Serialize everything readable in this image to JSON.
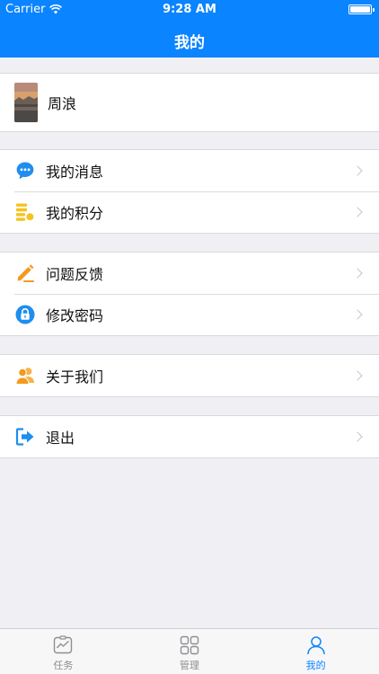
{
  "status_bar": {
    "carrier": "Carrier",
    "time": "9:28 AM"
  },
  "nav": {
    "title": "我的"
  },
  "profile": {
    "name": "周浪"
  },
  "groups": [
    {
      "items": [
        {
          "label": "我的消息",
          "icon": "message-icon",
          "color": "#1e8ef0"
        },
        {
          "label": "我的积分",
          "icon": "points-icon",
          "color": "#f5c31c"
        }
      ]
    },
    {
      "items": [
        {
          "label": "问题反馈",
          "icon": "pencil-icon",
          "color": "#f39a1f"
        },
        {
          "label": "修改密码",
          "icon": "lock-icon",
          "color": "#1e8ef0"
        }
      ]
    },
    {
      "items": [
        {
          "label": "关于我们",
          "icon": "people-icon",
          "color": "#f39a1f"
        }
      ]
    },
    {
      "items": [
        {
          "label": "退出",
          "icon": "logout-icon",
          "color": "#1e8ef0"
        }
      ]
    }
  ],
  "tabbar": {
    "tabs": [
      {
        "label": "任务",
        "icon": "task-icon",
        "active": false
      },
      {
        "label": "管理",
        "icon": "grid-icon",
        "active": false
      },
      {
        "label": "我的",
        "icon": "person-icon",
        "active": true
      }
    ]
  },
  "colors": {
    "accent": "#0a84ff",
    "background": "#efeff4"
  }
}
